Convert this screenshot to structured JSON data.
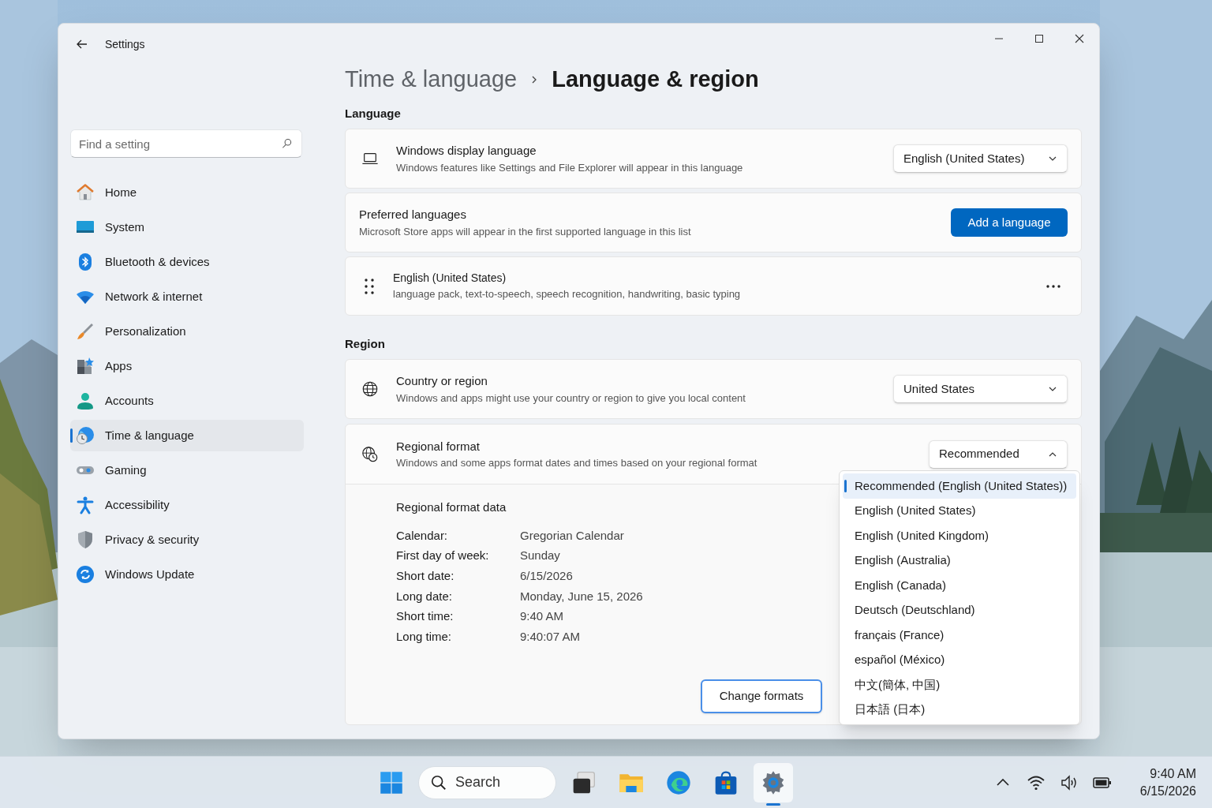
{
  "window": {
    "title": "Settings"
  },
  "search": {
    "placeholder": "Find a setting"
  },
  "sidebar": {
    "items": [
      {
        "label": "Home",
        "kind": "home",
        "selected": false
      },
      {
        "label": "System",
        "kind": "system",
        "selected": false
      },
      {
        "label": "Bluetooth & devices",
        "kind": "bluetooth",
        "selected": false
      },
      {
        "label": "Network & internet",
        "kind": "network",
        "selected": false
      },
      {
        "label": "Personalization",
        "kind": "personalization",
        "selected": false
      },
      {
        "label": "Apps",
        "kind": "apps",
        "selected": false
      },
      {
        "label": "Accounts",
        "kind": "accounts",
        "selected": false
      },
      {
        "label": "Time & language",
        "kind": "time",
        "selected": true
      },
      {
        "label": "Gaming",
        "kind": "gaming",
        "selected": false
      },
      {
        "label": "Accessibility",
        "kind": "accessibility",
        "selected": false
      },
      {
        "label": "Privacy & security",
        "kind": "privacy",
        "selected": false
      },
      {
        "label": "Windows Update",
        "kind": "update",
        "selected": false
      }
    ]
  },
  "breadcrumb": {
    "parent": "Time & language",
    "current": "Language & region"
  },
  "language": {
    "heading": "Language",
    "display_language": {
      "title": "Windows display language",
      "description": "Windows features like Settings and File Explorer will appear in this language",
      "value": "English (United States)"
    },
    "preferred": {
      "title": "Preferred languages",
      "description": "Microsoft Store apps will appear in the first supported language in this list",
      "button": "Add a language"
    },
    "installed": [
      {
        "name": "English (United States)",
        "features": "language pack, text-to-speech, speech recognition, handwriting, basic typing"
      }
    ]
  },
  "region": {
    "heading": "Region",
    "country": {
      "title": "Country or region",
      "description": "Windows and apps might use your country or region to give you local content",
      "value": "United States"
    },
    "format": {
      "title": "Regional format",
      "description": "Windows and some apps format dates and times based on your regional format",
      "value": "Recommended",
      "expanded": true,
      "data_heading": "Regional format data",
      "rows": [
        {
          "label": "Calendar:",
          "value": "Gregorian Calendar"
        },
        {
          "label": "First day of week:",
          "value": "Sunday"
        },
        {
          "label": "Short date:",
          "value": "6/15/2026"
        },
        {
          "label": "Long date:",
          "value": "Monday, June 15, 2026"
        },
        {
          "label": "Short time:",
          "value": "9:40 AM"
        },
        {
          "label": "Long time:",
          "value": "9:40:07 AM"
        }
      ],
      "button": "Change formats",
      "options": [
        {
          "label": "Recommended (English (United States))",
          "selected": true
        },
        {
          "label": "English (United States)",
          "selected": false
        },
        {
          "label": "English (United Kingdom)",
          "selected": false
        },
        {
          "label": "English (Australia)",
          "selected": false
        },
        {
          "label": "English (Canada)",
          "selected": false
        },
        {
          "label": "Deutsch (Deutschland)",
          "selected": false
        },
        {
          "label": "français (France)",
          "selected": false
        },
        {
          "label": "español (México)",
          "selected": false
        },
        {
          "label": "中文(簡体, 中国)",
          "selected": false
        },
        {
          "label": "日本語 (日本)",
          "selected": false
        }
      ]
    }
  },
  "taskbar": {
    "search": "Search",
    "apps": [
      {
        "kind": "taskview",
        "active": false
      },
      {
        "kind": "explorer",
        "active": false
      },
      {
        "kind": "edge",
        "active": false
      },
      {
        "kind": "store",
        "active": false
      },
      {
        "kind": "settings",
        "active": true
      }
    ],
    "time": "9:40 AM",
    "date": "6/15/2026"
  }
}
